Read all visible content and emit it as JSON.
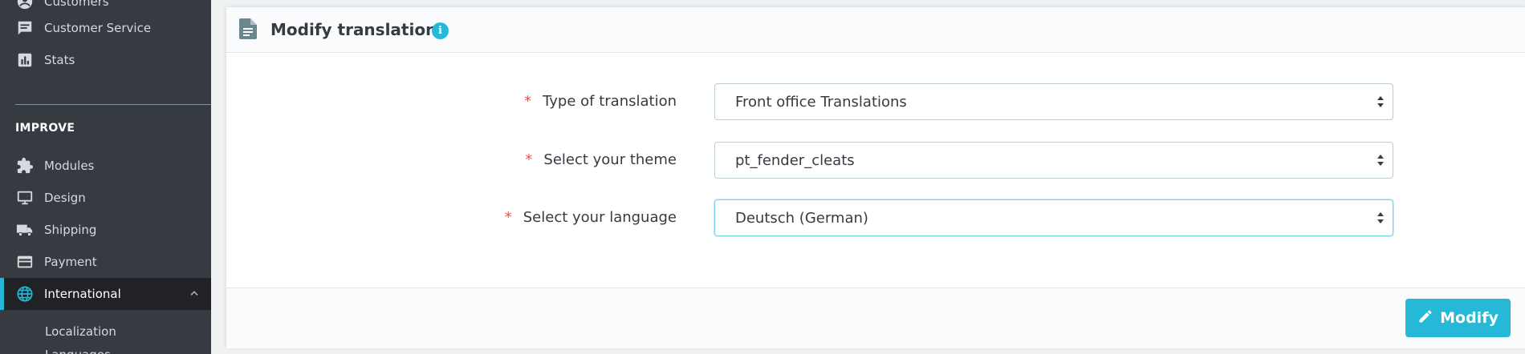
{
  "sidebar": {
    "items_top": [
      {
        "label": "Customers",
        "icon": "account-circle-icon"
      },
      {
        "label": "Customer Service",
        "icon": "chat-icon"
      },
      {
        "label": "Stats",
        "icon": "bar-chart-icon"
      }
    ],
    "section_label": "IMPROVE",
    "items": [
      {
        "label": "Modules",
        "icon": "puzzle-icon"
      },
      {
        "label": "Design",
        "icon": "desktop-icon"
      },
      {
        "label": "Shipping",
        "icon": "truck-icon"
      },
      {
        "label": "Payment",
        "icon": "credit-card-icon"
      },
      {
        "label": "International",
        "icon": "globe-icon",
        "active": true
      }
    ],
    "subitems": [
      "Localization",
      "Languages"
    ]
  },
  "panel": {
    "title": "Modify translations",
    "info_icon_text": "i",
    "fields": [
      {
        "label": "Type of translation",
        "required_mark": "*",
        "value": "Front office Translations"
      },
      {
        "label": "Select your theme",
        "required_mark": "*",
        "value": "pt_fender_cleats"
      },
      {
        "label": "Select your language",
        "required_mark": "*",
        "value": "Deutsch (German)"
      }
    ],
    "submit_label": "Modify"
  },
  "colors": {
    "accent": "#25b9d7",
    "sidebar_bg": "#363a41",
    "required": "#f54c3e"
  }
}
